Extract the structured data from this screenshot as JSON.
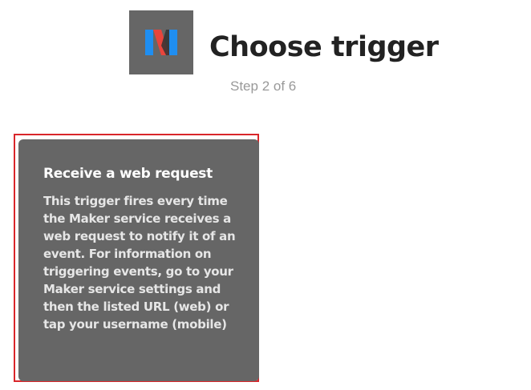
{
  "header": {
    "service_logo_icon": "maker-logo-icon",
    "title": "Choose trigger",
    "step": "Step 2 of 6"
  },
  "trigger_card": {
    "title": "Receive a web request",
    "description": "This trigger fires every time the Maker service receives a web request to notify it of an event. For information on triggering events, go to your Maker service settings and then the listed URL (web) or tap your username (mobile)",
    "highlighted": true
  },
  "colors": {
    "card_background": "#666666",
    "logo_background": "#666666",
    "highlight_border": "#d9262a",
    "title_text": "#222222",
    "step_text": "#999999",
    "logo_red": "#e8453c",
    "logo_blue": "#1f8ef1",
    "logo_dark": "#333333"
  }
}
